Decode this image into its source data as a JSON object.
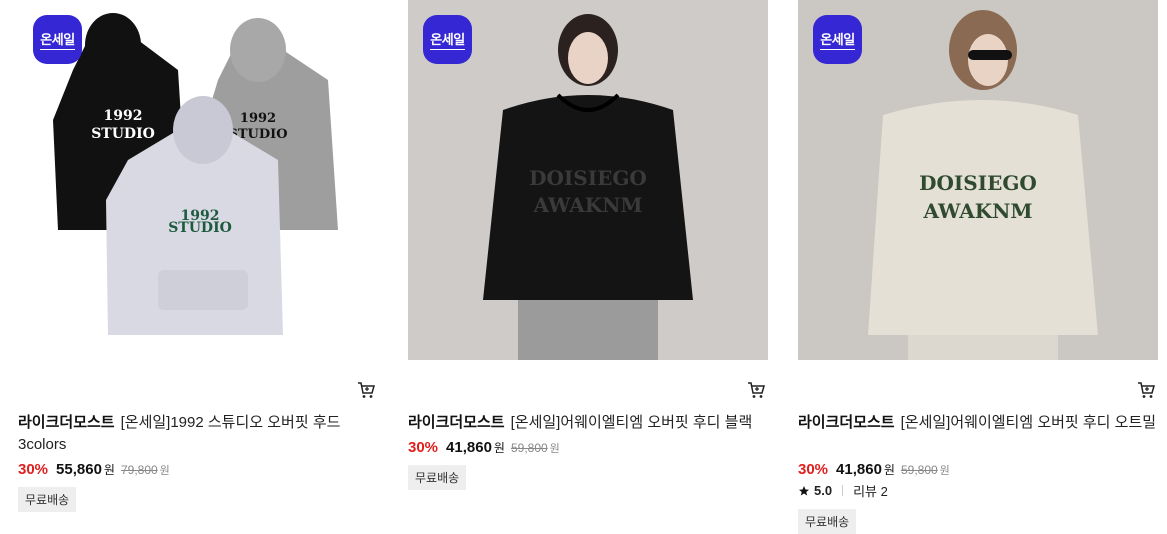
{
  "products": [
    {
      "badge": "온세일",
      "brand": "라이크더모스트",
      "name": "[온세일]1992 스튜디오 오버핏 후드 3colors",
      "discount": "30%",
      "price": "55,860",
      "price_unit": "원",
      "original_price": "79,800",
      "original_unit": "원",
      "shipping": "무료배송"
    },
    {
      "badge": "온세일",
      "brand": "라이크더모스트",
      "name": "[온세일]어웨이엘티엠 오버핏 후디 블랙",
      "discount": "30%",
      "price": "41,860",
      "price_unit": "원",
      "original_price": "59,800",
      "original_unit": "원",
      "shipping": "무료배송"
    },
    {
      "badge": "온세일",
      "brand": "라이크더모스트",
      "name": "[온세일]어웨이엘티엠 오버핏 후디 오트밀",
      "discount": "30%",
      "price": "41,860",
      "price_unit": "원",
      "original_price": "59,800",
      "original_unit": "원",
      "rating": "5.0",
      "review_label": "리뷰 2",
      "shipping": "무료배송"
    }
  ],
  "images": {
    "hoodie_print_1": "1992",
    "hoodie_print_2": "STUDIO",
    "hoodie_print_3": "DOISIEGO",
    "hoodie_print_4": "AWAKNM"
  },
  "colors": {
    "badge": "#3527d4",
    "discount": "#e02020"
  },
  "icons": [
    "cart-icon",
    "star-icon"
  ]
}
